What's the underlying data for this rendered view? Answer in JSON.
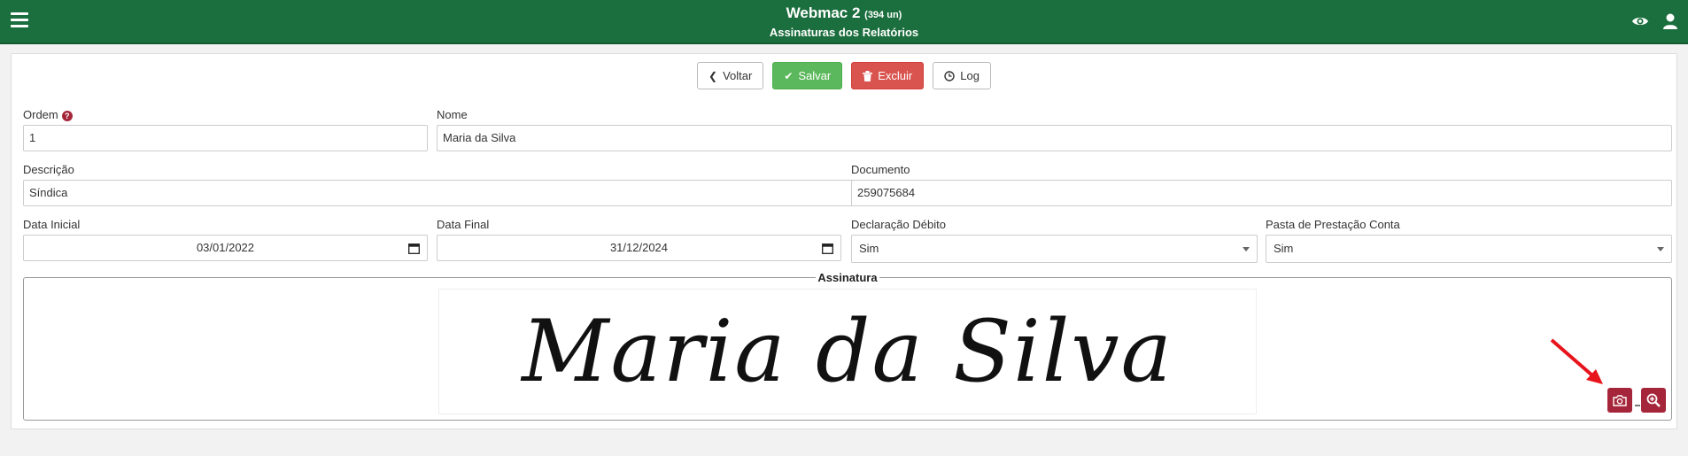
{
  "header": {
    "menu_icon": "hamburger-menu-icon",
    "app_title": "Webmac 2",
    "app_count": "(394 un)",
    "page_subtitle": "Assinaturas dos Relatórios",
    "right_icons": [
      "eye-icon",
      "user-icon"
    ],
    "bg_color": "#1b6e3d"
  },
  "toolbar": {
    "back_label": "Voltar",
    "save_label": "Salvar",
    "delete_label": "Excluir",
    "log_label": "Log"
  },
  "form": {
    "ordem": {
      "label": "Ordem",
      "value": "1"
    },
    "nome": {
      "label": "Nome",
      "value": "Maria da Silva"
    },
    "descricao": {
      "label": "Descrição",
      "value": "Síndica"
    },
    "documento": {
      "label": "Documento",
      "value": "259075684"
    },
    "data_inicial": {
      "label": "Data Inicial",
      "value": "03/01/2022"
    },
    "data_final": {
      "label": "Data Final",
      "value": "31/12/2024"
    },
    "declaracao_debito": {
      "label": "Declaração Débito",
      "value": "Sim"
    },
    "pasta_prestacao": {
      "label": "Pasta de Prestação Conta",
      "value": "Sim"
    }
  },
  "signature": {
    "legend": "Assinatura",
    "image_text": "Maria da Silva",
    "camera_icon": "camera-icon",
    "zoom_icon": "zoom-in-icon",
    "accent_color": "#a5263a"
  },
  "annotation": {
    "arrow_color": "#e8141c"
  }
}
